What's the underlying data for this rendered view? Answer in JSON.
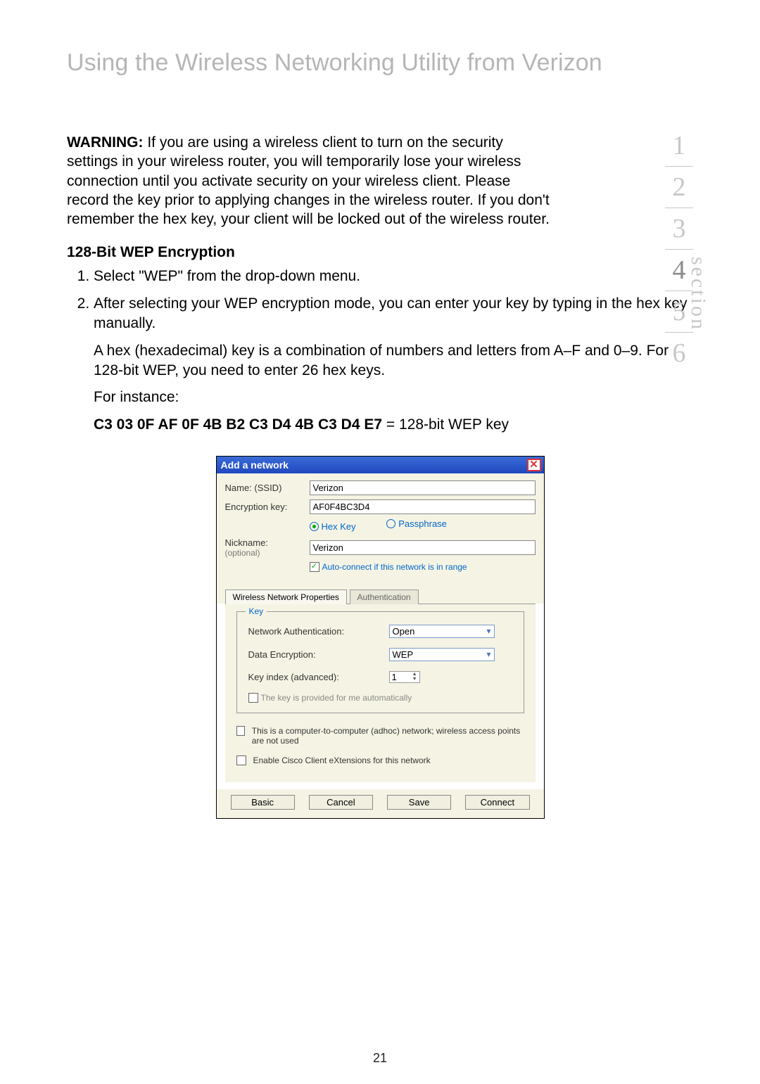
{
  "page_title": "Using the Wireless Networking Utility from Verizon",
  "warning_label": "WARNING:",
  "warning_text": " If you are using a wireless client to turn on the security settings in your wireless router, you will temporarily lose your wireless connection until you activate security on your wireless client. Please record the key prior to applying changes in the wireless router. If you don't remember the hex key, your client will be locked out of the wireless router.",
  "section_heading": "128-Bit WEP Encryption",
  "step1": "Select \"WEP\" from the drop-down menu.",
  "step2a": "After selecting your WEP encryption mode, you can enter your key by typing in the hex key manually.",
  "step2b": "A hex (hexadecimal) key is a combination of numbers and letters from A–F and 0–9. For 128-bit WEP, you need to enter 26 hex keys.",
  "step2c": "For instance:",
  "wep_key_bold": "C3 03 0F AF 0F 4B B2 C3 D4 4B C3 D4 E7",
  "wep_key_rest": " = 128-bit WEP key",
  "side_nav": {
    "items": [
      "1",
      "2",
      "3",
      "4",
      "5",
      "6"
    ],
    "current": "4",
    "label": "section"
  },
  "dialog": {
    "title": "Add a network",
    "name_label": "Name:  (SSID)",
    "name_value": "Verizon",
    "enc_label": "Encryption key:",
    "enc_value": "AF0F4BC3D4",
    "radio_hex": "Hex Key",
    "radio_pass": "Passphrase",
    "nick_label": "Nickname:",
    "nick_sub": "(optional)",
    "nick_value": "Verizon",
    "auto_connect": "Auto-connect if this network is in range",
    "tab_props": "Wireless Network Properties",
    "tab_auth": "Authentication",
    "key_legend": "Key",
    "net_auth_label": "Network Authentication:",
    "net_auth_value": "Open",
    "data_enc_label": "Data Encryption:",
    "data_enc_value": "WEP",
    "key_index_label": "Key index (advanced):",
    "key_index_value": "1",
    "auto_key": "The key is provided for me automatically",
    "adhoc": "This is a computer-to-computer (adhoc) network; wireless access points are not used",
    "cisco": "Enable Cisco Client eXtensions for this network",
    "btn_basic": "Basic",
    "btn_cancel": "Cancel",
    "btn_save": "Save",
    "btn_connect": "Connect"
  },
  "page_number": "21"
}
